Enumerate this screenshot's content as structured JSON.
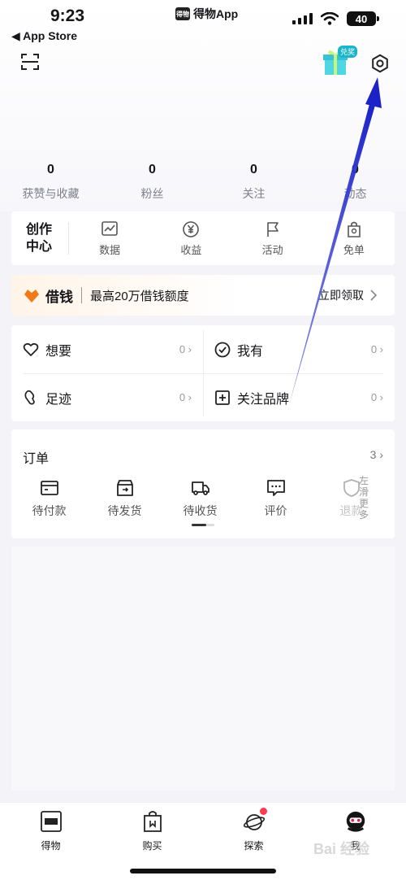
{
  "status_bar": {
    "time": "9:23",
    "back_label": "◀ App Store",
    "app_name": "得物App",
    "app_logo_text": "得物",
    "battery": "40"
  },
  "header": {
    "gift_badge": "兑奖"
  },
  "stats": [
    {
      "value": "0",
      "label": "获赞与收藏"
    },
    {
      "value": "0",
      "label": "粉丝"
    },
    {
      "value": "0",
      "label": "关注"
    },
    {
      "value": "0",
      "label": "动态"
    }
  ],
  "creator": {
    "title_line1": "创作",
    "title_line2": "中心",
    "items": [
      {
        "label": "数据",
        "icon": "chart-icon"
      },
      {
        "label": "收益",
        "icon": "yen-icon"
      },
      {
        "label": "活动",
        "icon": "flag-icon"
      },
      {
        "label": "免单",
        "icon": "bag-icon"
      }
    ]
  },
  "loan": {
    "name": "借钱",
    "description": "最高20万借钱额度",
    "cta": "立即领取"
  },
  "favorites": [
    {
      "label": "想要",
      "count": "0",
      "icon": "heart-icon"
    },
    {
      "label": "我有",
      "count": "0",
      "icon": "check-circle-icon"
    },
    {
      "label": "足迹",
      "count": "0",
      "icon": "footprint-icon"
    },
    {
      "label": "关注品牌",
      "count": "0",
      "icon": "plus-square-icon"
    }
  ],
  "orders": {
    "title": "订单",
    "count": "3",
    "items": [
      {
        "label": "待付款",
        "icon": "card-icon"
      },
      {
        "label": "待发货",
        "icon": "box-icon"
      },
      {
        "label": "待收货",
        "icon": "truck-icon"
      },
      {
        "label": "评价",
        "icon": "comment-icon"
      },
      {
        "label": "退款",
        "icon": "shield-icon"
      }
    ],
    "swipe_hint": "左滑更多"
  },
  "tabbar": [
    {
      "label": "得物",
      "icon": "dewu-logo-icon"
    },
    {
      "label": "购买",
      "icon": "shopping-bag-icon"
    },
    {
      "label": "探索",
      "icon": "planet-icon"
    },
    {
      "label": "我",
      "icon": "avatar-icon"
    }
  ],
  "colors": {
    "accent_orange": "#f07a1a",
    "annotation_arrow": "#1a22c8",
    "red_dot": "#ff3b4f"
  },
  "watermark": "Bai 经验"
}
